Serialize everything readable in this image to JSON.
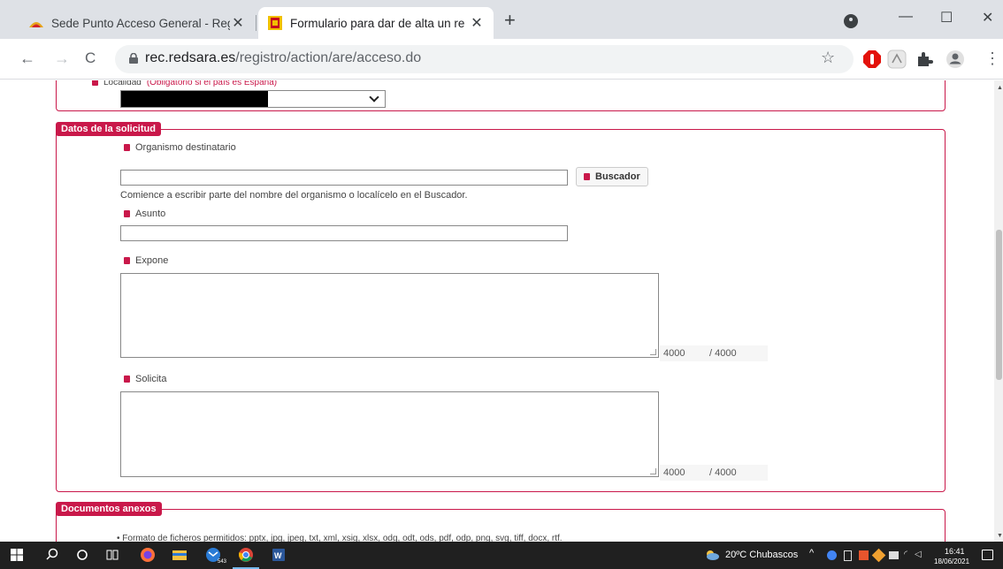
{
  "browser": {
    "tabs": [
      {
        "title": "Sede Punto Acceso General - Reg",
        "active": false
      },
      {
        "title": "Formulario para dar de alta un re",
        "active": true
      }
    ],
    "new_tab": "+",
    "url_host": "rec.redsara.es",
    "url_path": "/registro/action/are/acceso.do",
    "window": {
      "minimize": "—",
      "maximize": "☐",
      "close": "✕"
    },
    "nav": {
      "back": "←",
      "forward": "→",
      "reload": "C"
    },
    "star": "☆"
  },
  "form": {
    "location_section": {
      "localidad_label": "Localidad",
      "localidad_note": "(Obligatorio si el país es España)"
    },
    "datos_solicitud": {
      "legend": "Datos de la solicitud",
      "organismo_label": "Organismo destinatario",
      "organismo_value": "",
      "buscador_button": "Buscador",
      "organismo_hint": "Comience a escribir parte del nombre del organismo o localícelo en el Buscador.",
      "asunto_label": "Asunto",
      "asunto_value": "",
      "expone_label": "Expone",
      "expone_count": "4000",
      "expone_max": "/  4000",
      "solicita_label": "Solicita",
      "solicita_count": "4000",
      "solicita_max": "/  4000"
    },
    "documentos": {
      "legend": "Documentos anexos",
      "formats": "• Formato de ficheros permitidos: pptx, jpg, jpeg, txt, xml, xsig, xlsx, odg, odt, ods, pdf, odp, png, svg, tiff, docx, rtf."
    }
  },
  "taskbar": {
    "weather": "20ºC  Chubascos",
    "time": "16:41",
    "date": "18/06/2021",
    "mail_badge": "543"
  },
  "colors": {
    "accent": "#c9184a",
    "taskbar": "#202020",
    "tabstrip": "#dee1e6"
  }
}
